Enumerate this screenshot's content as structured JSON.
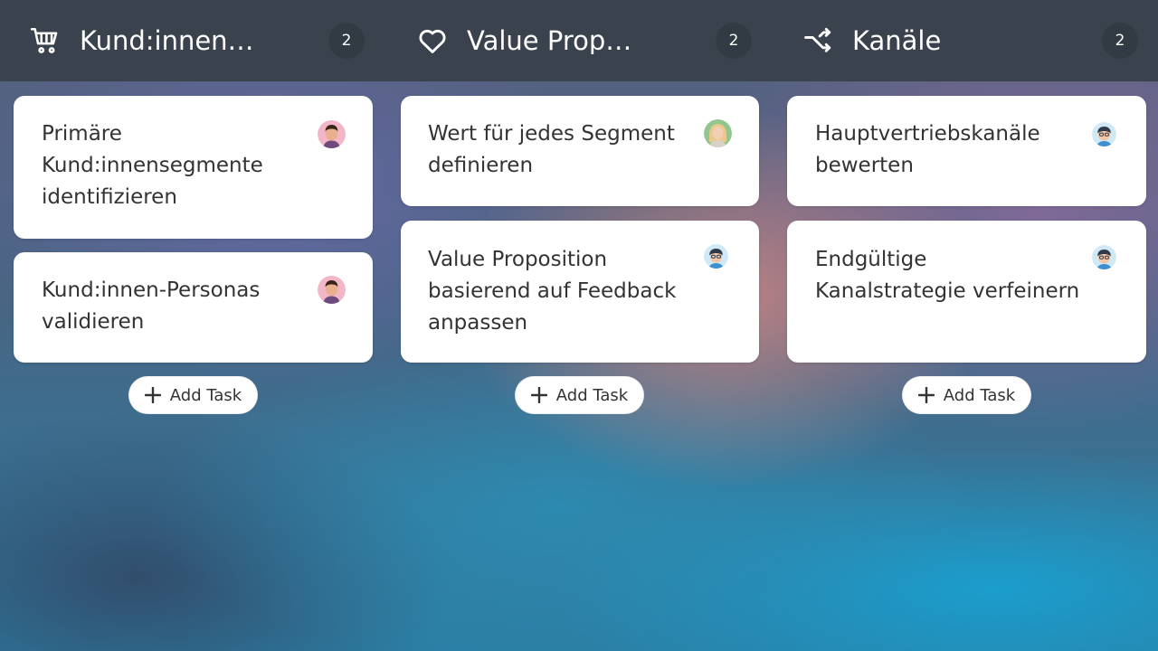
{
  "columns": [
    {
      "title": "Kund:innen…",
      "count": "2",
      "icon": "shopping-cart-icon",
      "cards": [
        {
          "title": "Primäre Kund:innensegmente identifizieren",
          "assignee_icon": "avatar-man-icon"
        },
        {
          "title": "Kund:innen-Personas validieren",
          "assignee_icon": "avatar-man-icon"
        }
      ],
      "add_task_label": "Add Task"
    },
    {
      "title": "Value Prop…",
      "count": "2",
      "icon": "heart-icon",
      "cards": [
        {
          "title": "Wert für jedes Segment definieren",
          "assignee_icon": "avatar-woman-icon"
        },
        {
          "title": "Value Proposition basierend auf Feedback anpassen",
          "assignee_icon": "avatar-cartoon-icon"
        }
      ],
      "add_task_label": "Add Task"
    },
    {
      "title": "Kanäle",
      "count": "2",
      "icon": "shuffle-icon",
      "cards": [
        {
          "title": "Hauptvertriebskanäle bewerten",
          "assignee_icon": "avatar-cartoon-icon"
        },
        {
          "title": "Endgültige Kanalstrategie verfeinern",
          "assignee_icon": "avatar-cartoon-icon"
        }
      ],
      "add_task_label": "Add Task"
    }
  ]
}
